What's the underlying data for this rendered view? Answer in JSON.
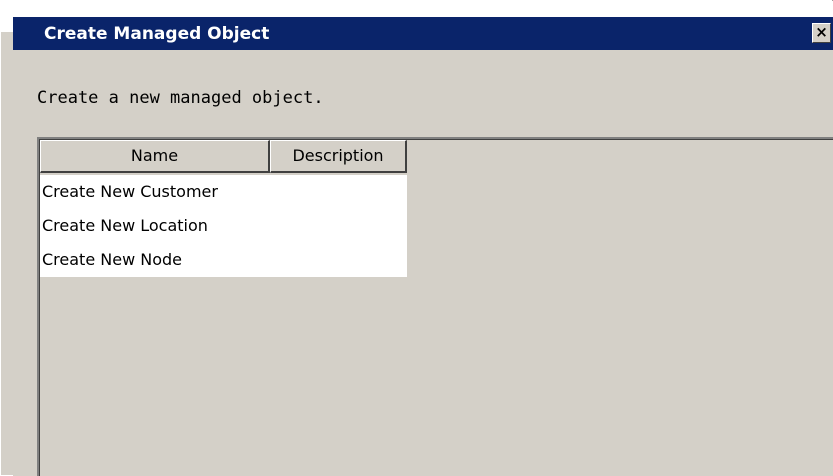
{
  "window": {
    "title": "Create Managed Object",
    "close_label": "×"
  },
  "instruction": "Create a new managed object.",
  "table": {
    "columns": [
      "Name",
      "Description"
    ],
    "rows": [
      {
        "name": "Create New Customer",
        "description": ""
      },
      {
        "name": "Create New Location",
        "description": ""
      },
      {
        "name": "Create New Node",
        "description": ""
      }
    ]
  },
  "colors": {
    "title_bar": "#0a246a",
    "title_text": "#ffffff",
    "dialog_bg": "#d4d0c8",
    "list_bg": "#ffffff"
  },
  "icons": {
    "close": "close-icon"
  }
}
